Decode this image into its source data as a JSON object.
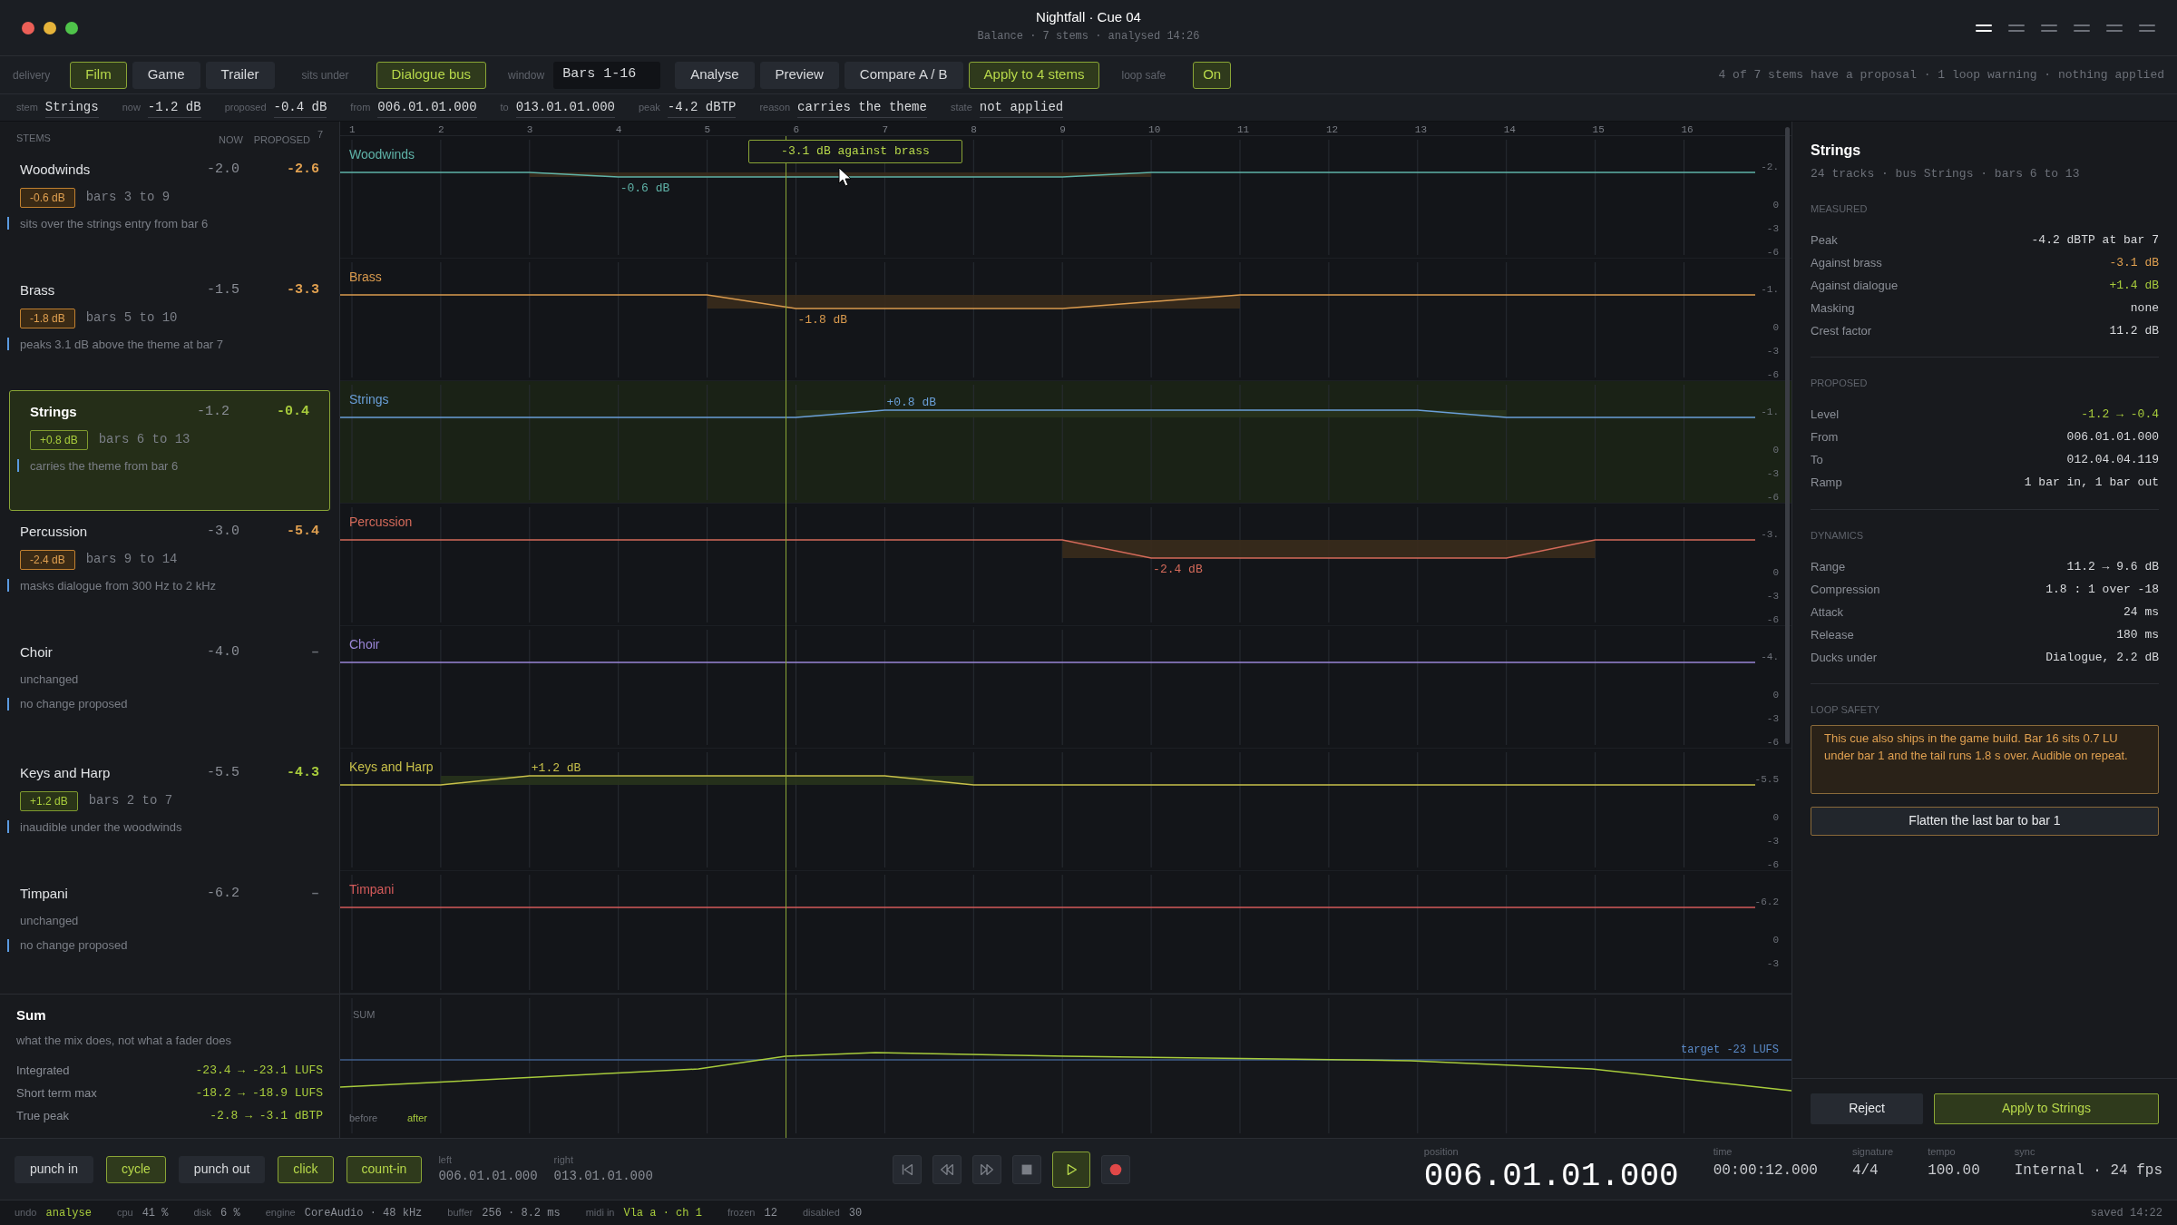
{
  "window": {
    "title": "Nightfall · Cue 04",
    "subtitle": "Balance · 7 stems · analysed 14:26"
  },
  "layout_buttons": [
    {
      "selected": true
    },
    {
      "selected": false
    },
    {
      "selected": false
    },
    {
      "selected": false
    },
    {
      "selected": false
    },
    {
      "selected": false
    }
  ],
  "toolbar": {
    "delivery_label": "delivery",
    "delivery": [
      {
        "label": "Film",
        "selected": true
      },
      {
        "label": "Game",
        "selected": false
      },
      {
        "label": "Trailer",
        "selected": false
      }
    ],
    "sits_under_label": "sits under",
    "sits_under": {
      "label": "Dialogue bus",
      "on": true
    },
    "window_label": "window",
    "window_value": "Bars 1-16",
    "actions": [
      {
        "label": "Analyse",
        "primary": false
      },
      {
        "label": "Preview",
        "primary": false
      },
      {
        "label": "Compare A / B",
        "primary": false
      },
      {
        "label": "Apply to 4 stems",
        "primary": true
      }
    ],
    "loop_safe_label": "loop safe",
    "loop_safe": {
      "label": "On",
      "on": true
    },
    "summary": "4 of 7 stems have a proposal · 1 loop warning · nothing applied"
  },
  "info_row": [
    {
      "label": "stem",
      "value": "Strings"
    },
    {
      "label": "now",
      "value": "-1.2 dB"
    },
    {
      "label": "proposed",
      "value": "-0.4 dB"
    },
    {
      "label": "from",
      "value": "006.01.01.000"
    },
    {
      "label": "to",
      "value": "013.01.01.000"
    },
    {
      "label": "peak",
      "value": "-4.2 dBTP"
    },
    {
      "label": "reason",
      "value": "carries the theme"
    },
    {
      "label": "state",
      "value": "not applied"
    }
  ],
  "stems_panel": {
    "heading": "STEMS",
    "count": "7",
    "col_now": "NOW",
    "col_proposed": "PROPOSED",
    "stems": [
      {
        "name": "Woodwinds",
        "now": "-2.0",
        "proposed": "-2.6",
        "kind": "cut",
        "change": "-0.6 dB",
        "bars": "bars 3 to 9",
        "note": "sits over the strings entry from bar 6",
        "selected": false
      },
      {
        "name": "Brass",
        "now": "-1.5",
        "proposed": "-3.3",
        "kind": "cut",
        "change": "-1.8 dB",
        "bars": "bars 5 to 10",
        "note": "peaks 3.1 dB above the theme at bar 7",
        "selected": false
      },
      {
        "name": "Strings",
        "now": "-1.2",
        "proposed": "-0.4",
        "kind": "boost",
        "change": "+0.8 dB",
        "bars": "bars 6 to 13",
        "note": "carries the theme from bar 6",
        "selected": true
      },
      {
        "name": "Percussion",
        "now": "-3.0",
        "proposed": "-5.4",
        "kind": "cut",
        "change": "-2.4 dB",
        "bars": "bars 9 to 14",
        "note": "masks dialogue from 300 Hz to 2 kHz",
        "selected": false
      },
      {
        "name": "Choir",
        "now": "-4.0",
        "proposed": "–",
        "kind": "none",
        "status": "unchanged",
        "note": "no change proposed",
        "selected": false
      },
      {
        "name": "Keys and Harp",
        "now": "-5.5",
        "proposed": "-4.3",
        "kind": "boost",
        "change": "+1.2 dB",
        "bars": "bars 2 to 7",
        "note": "inaudible under the woodwinds",
        "selected": false
      },
      {
        "name": "Timpani",
        "now": "-6.2",
        "proposed": "–",
        "kind": "none",
        "status": "unchanged",
        "note": "no change proposed",
        "selected": false
      }
    ],
    "sum": {
      "title": "Sum",
      "subtitle": "what the mix does, not what a fader does",
      "rows": [
        {
          "label": "Integrated",
          "value": "-23.4 → -23.1 LUFS"
        },
        {
          "label": "Short term max",
          "value": "-18.2 → -18.9 LUFS"
        },
        {
          "label": "True peak",
          "value": "-2.8 → -3.1 dBTP"
        }
      ]
    }
  },
  "timeline": {
    "ruler": [
      "1",
      "2",
      "3",
      "4",
      "5",
      "6",
      "7",
      "8",
      "9",
      "10",
      "11",
      "12",
      "13",
      "14",
      "15",
      "16"
    ],
    "tooltip": "-3.1 dB against brass",
    "lanes": [
      {
        "name": "Woodwinds",
        "color": "#5fb3a8",
        "kind": "cut",
        "label": "-0.6 dB",
        "axis": [
          "-2.",
          "0",
          "-3",
          "-6"
        ],
        "selected": false
      },
      {
        "name": "Brass",
        "color": "#d99a4e",
        "kind": "cut",
        "label": "-1.8 dB",
        "axis": [
          "-1.",
          "0",
          "-3",
          "-6"
        ],
        "selected": false
      },
      {
        "name": "Strings",
        "color": "#6a9fd8",
        "kind": "boost",
        "label": "+0.8 dB",
        "axis": [
          "-1.",
          "0",
          "-3",
          "-6"
        ],
        "selected": true
      },
      {
        "name": "Percussion",
        "color": "#d46a5a",
        "kind": "cut",
        "label": "-2.4 dB",
        "axis": [
          "-3.",
          "0",
          "-3",
          "-6"
        ],
        "selected": false
      },
      {
        "name": "Choir",
        "color": "#9a86d6",
        "kind": "none",
        "axis": [
          "-4.",
          "0",
          "-3",
          "-6"
        ],
        "selected": false
      },
      {
        "name": "Keys and Harp",
        "color": "#c8c04a",
        "kind": "boost",
        "label": "+1.2 dB",
        "axis": [
          "-5.5",
          "0",
          "-3",
          "-6"
        ],
        "selected": false
      },
      {
        "name": "Timpani",
        "color": "#d45a5a",
        "kind": "none",
        "axis": [
          "-6.2",
          "0",
          "-3"
        ],
        "selected": false
      }
    ],
    "sum": {
      "label": "SUM",
      "target": "target -23 LUFS",
      "legend_before": "before",
      "legend_after": "after"
    }
  },
  "inspector": {
    "title": "Strings",
    "subtitle": "24 tracks · bus Strings · bars 6 to 13",
    "sections": [
      {
        "heading": "MEASURED",
        "rows": [
          {
            "label": "Peak",
            "value": "-4.2 dBTP at bar 7",
            "kind": "normal"
          },
          {
            "label": "Against brass",
            "value": "-3.1 dB",
            "kind": "cut"
          },
          {
            "label": "Against dialogue",
            "value": "+1.4 dB",
            "kind": "boost"
          },
          {
            "label": "Masking",
            "value": "none",
            "kind": "normal"
          },
          {
            "label": "Crest factor",
            "value": "11.2 dB",
            "kind": "normal"
          }
        ]
      },
      {
        "heading": "PROPOSED",
        "rows": [
          {
            "label": "Level",
            "value": "-1.2 → -0.4",
            "kind": "boost"
          },
          {
            "label": "From",
            "value": "006.01.01.000",
            "kind": "normal"
          },
          {
            "label": "To",
            "value": "012.04.04.119",
            "kind": "normal"
          },
          {
            "label": "Ramp",
            "value": "1 bar in, 1 bar out",
            "kind": "normal"
          }
        ]
      },
      {
        "heading": "DYNAMICS",
        "rows": [
          {
            "label": "Range",
            "value": "11.2 → 9.6 dB",
            "kind": "normal"
          },
          {
            "label": "Compression",
            "value": "1.8 : 1 over -18",
            "kind": "normal"
          },
          {
            "label": "Attack",
            "value": "24 ms",
            "kind": "normal"
          },
          {
            "label": "Release",
            "value": "180 ms",
            "kind": "normal"
          },
          {
            "label": "Ducks under",
            "value": "Dialogue, 2.2 dB",
            "kind": "normal"
          }
        ]
      }
    ],
    "loop_safety": {
      "heading": "LOOP SAFETY",
      "warning": "This cue also ships in the game build. Bar 16 sits 0.7 LU under bar 1 and the tail runs 1.8 s over. Audible on repeat.",
      "action": "Flatten the last bar to bar 1"
    },
    "reject": "Reject",
    "apply": "Apply to Strings"
  },
  "transport": {
    "toggles": [
      {
        "label": "punch in",
        "on": false
      },
      {
        "label": "cycle",
        "on": true
      },
      {
        "label": "punch out",
        "on": false
      },
      {
        "label": "click",
        "on": true
      },
      {
        "label": "count-in",
        "on": true
      }
    ],
    "locators": [
      {
        "label": "left",
        "value": "006.01.01.000"
      },
      {
        "label": "right",
        "value": "013.01.01.000"
      }
    ],
    "controls": [
      {
        "kind": "skip-back",
        "active": false
      },
      {
        "kind": "rewind",
        "active": false
      },
      {
        "kind": "fast-forward",
        "active": false
      },
      {
        "kind": "stop",
        "active": false
      },
      {
        "kind": "play",
        "active": true
      },
      {
        "kind": "record",
        "active": false
      }
    ],
    "position": {
      "label": "position",
      "value": "006.01.01.000"
    },
    "readouts": [
      {
        "label": "time",
        "value": "00:00:12.000"
      },
      {
        "label": "signature",
        "value": "4/4"
      },
      {
        "label": "tempo",
        "value": "100.00"
      },
      {
        "label": "sync",
        "value": "Internal · 24 fps"
      }
    ]
  },
  "status_bar": {
    "items": [
      {
        "label": "undo",
        "value": "analyse",
        "accent": true
      },
      {
        "label": "cpu",
        "value": "41 %",
        "accent": false
      },
      {
        "label": "disk",
        "value": "6 %",
        "accent": false
      },
      {
        "label": "engine",
        "value": "CoreAudio · 48 kHz",
        "accent": false
      },
      {
        "label": "buffer",
        "value": "256 · 8.2 ms",
        "accent": false
      },
      {
        "label": "midi in",
        "value": "Vla a · ch 1",
        "accent": true
      },
      {
        "label": "frozen",
        "value": "12",
        "accent": false
      },
      {
        "label": "disabled",
        "value": "30",
        "accent": false
      }
    ],
    "saved": "saved 14:22"
  }
}
